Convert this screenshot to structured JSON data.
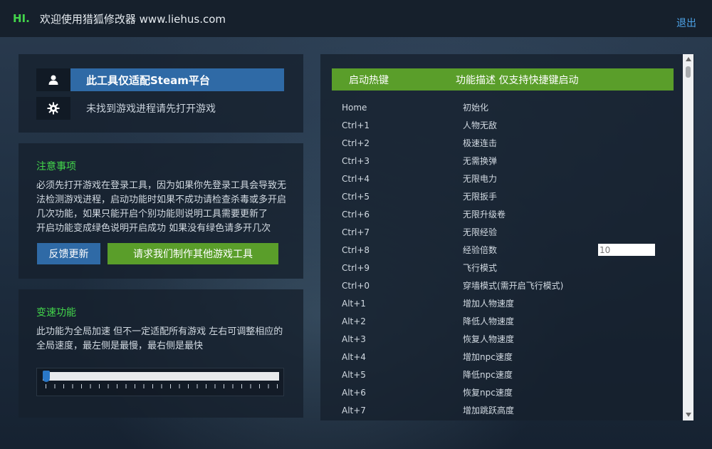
{
  "header": {
    "greeting": "HI.",
    "title": "欢迎使用猎狐修改器 www.liehus.com",
    "logout_label": "退出"
  },
  "status_panel": {
    "platform_text": "此工具仅适配Steam平台",
    "process_text": "未找到游戏进程请先打开游戏",
    "user_icon": "user-icon",
    "gear_icon": "gear-icon"
  },
  "notice_panel": {
    "title": "注意事项",
    "lines": [
      "必须先打开游戏在登录工具，因为如果你先登录工具会导致无",
      "法检测游戏进程，启动功能时如果不成功请检查杀毒或多开启",
      "几次功能，如果只能开启个别功能则说明工具需要更新了",
      "开启功能变成绿色说明开启成功 如果没有绿色请多开几次"
    ],
    "feedback_label": "反馈更新",
    "request_label": "请求我们制作其他游戏工具"
  },
  "speed_panel": {
    "title": "变速功能",
    "lines": [
      "此功能为全局加速 但不一定适配所有游戏 左右可调整相应的",
      "全局速度，最左侧是最慢，最右侧是最快"
    ],
    "slider_level": 0
  },
  "hotkeys": {
    "header_key": "启动热键",
    "header_desc": "功能描述 仅支持快捷键启动",
    "rows": [
      {
        "key": "Home",
        "desc": "初始化"
      },
      {
        "key": "Ctrl+1",
        "desc": "人物无敌"
      },
      {
        "key": "Ctrl+2",
        "desc": "极速连击"
      },
      {
        "key": "Ctrl+3",
        "desc": "无需换弹"
      },
      {
        "key": "Ctrl+4",
        "desc": "无限电力"
      },
      {
        "key": "Ctrl+5",
        "desc": "无限扳手"
      },
      {
        "key": "Ctrl+6",
        "desc": "无限升级卷"
      },
      {
        "key": "Ctrl+7",
        "desc": "无限经验"
      },
      {
        "key": "Ctrl+8",
        "desc": "经验倍数",
        "input_placeholder": "10"
      },
      {
        "key": "Ctrl+9",
        "desc": "飞行模式"
      },
      {
        "key": "Ctrl+0",
        "desc": "穿墙模式(需开启飞行模式)"
      },
      {
        "key": "Alt+1",
        "desc": "增加人物速度"
      },
      {
        "key": "Alt+2",
        "desc": "降低人物速度"
      },
      {
        "key": "Alt+3",
        "desc": "恢复人物速度"
      },
      {
        "key": "Alt+4",
        "desc": "增加npc速度"
      },
      {
        "key": "Alt+5",
        "desc": "降低npc速度"
      },
      {
        "key": "Alt+6",
        "desc": "恢复npc速度"
      },
      {
        "key": "Alt+7",
        "desc": "增加跳跃高度"
      }
    ]
  },
  "colors": {
    "accent_green": "#43d64b",
    "button_blue": "#2f6aa6",
    "button_green": "#5a9e2a",
    "link_blue": "#4ea3e8"
  }
}
